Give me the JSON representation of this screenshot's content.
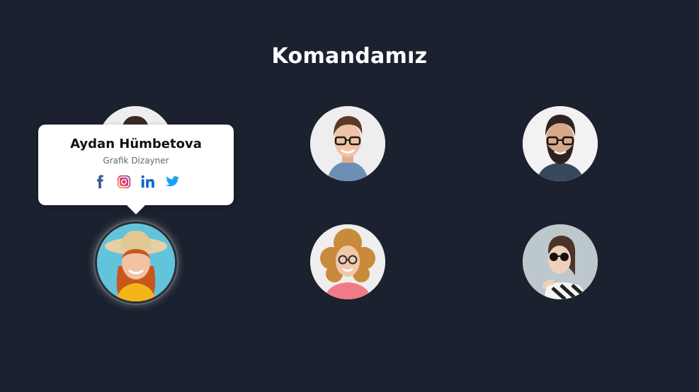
{
  "section": {
    "title": "Komandamız"
  },
  "tooltip": {
    "name": "Aydan Hümbetova",
    "role": "Grafik Dizayner",
    "socials": [
      {
        "icon": "facebook-icon",
        "color": "#3b5998"
      },
      {
        "icon": "instagram-icon",
        "color": "#e1306c"
      },
      {
        "icon": "linkedin-icon",
        "color": "#0a66c2"
      },
      {
        "icon": "twitter-icon",
        "color": "#1da1f2"
      }
    ]
  },
  "colors": {
    "background": "#1b212e",
    "card": "#ffffff",
    "title": "#ffffff"
  }
}
